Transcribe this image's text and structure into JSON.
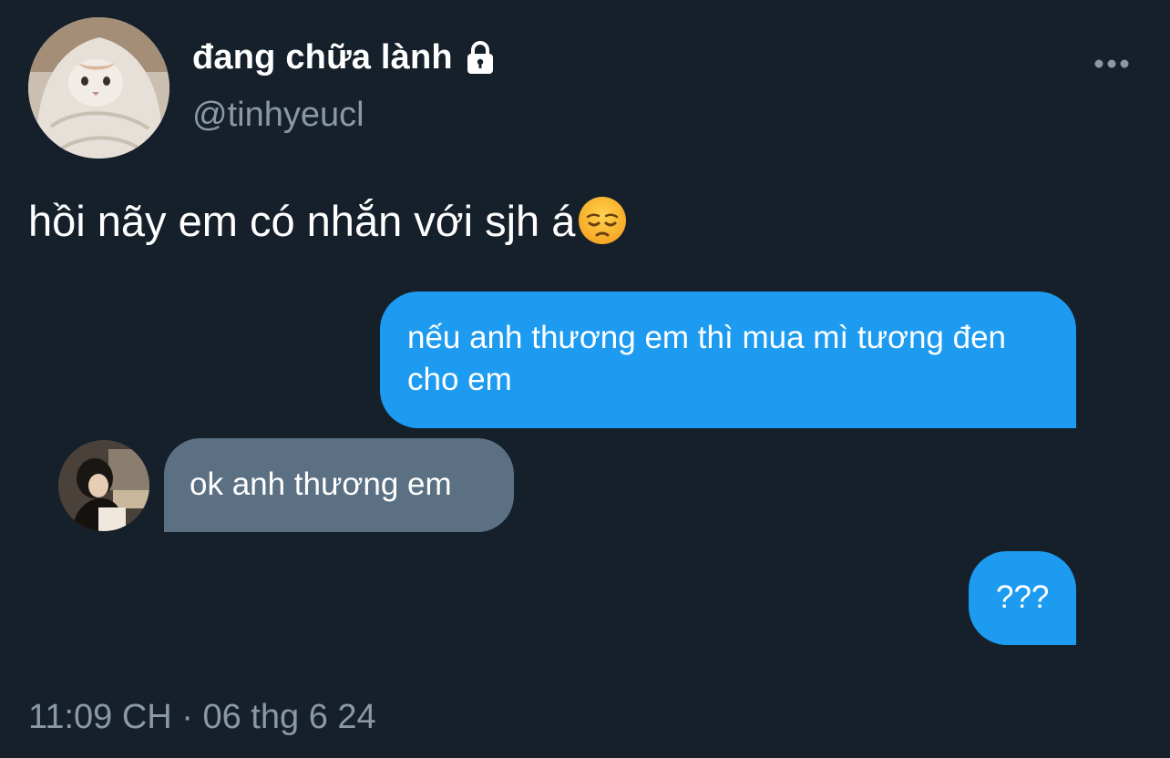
{
  "header": {
    "display_name": "đang chữa lành",
    "handle": "@tinhyeucl",
    "lock_icon": "lock-icon",
    "more_icon": "more-horizontal-icon"
  },
  "tweet": {
    "text": "hồi nãy em có nhắn với sjh á",
    "emoji": "pensive-face-emoji"
  },
  "chat": {
    "messages": [
      {
        "side": "sent",
        "text": "nếu anh thương em thì mua mì tương đen cho em"
      },
      {
        "side": "received",
        "text": "ok anh thương em"
      },
      {
        "side": "sent",
        "text": "???"
      }
    ]
  },
  "footer": {
    "timestamp": "11:09 CH · 06 thg 6 24"
  },
  "colors": {
    "background": "#15202b",
    "sent_bubble": "#1d9bf0",
    "received_bubble": "#5b7083",
    "secondary_text": "#8b98a5"
  }
}
